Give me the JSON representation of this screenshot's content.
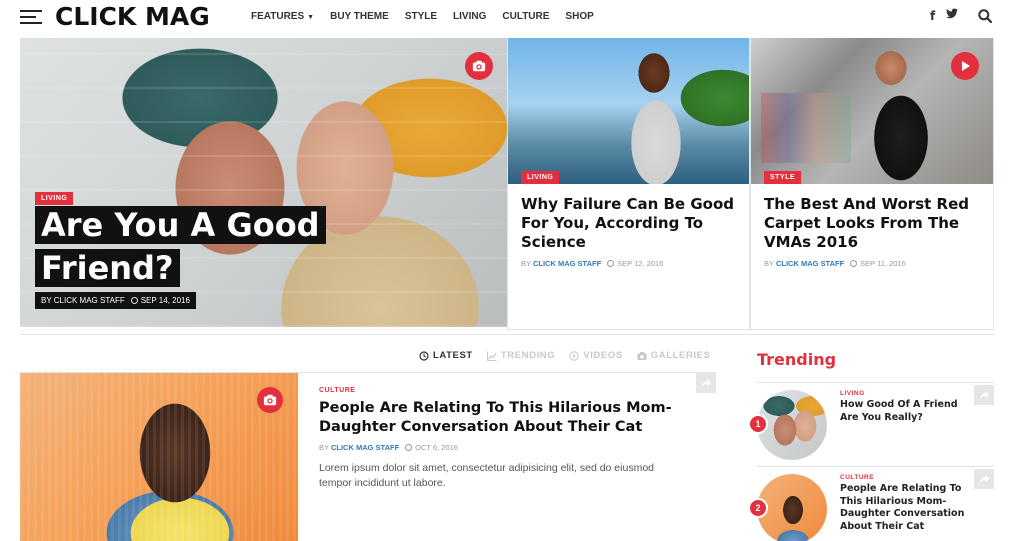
{
  "header": {
    "logo": "CLICK MAG",
    "nav": [
      {
        "label": "FEATURES",
        "has_dropdown": true
      },
      {
        "label": "BUY THEME"
      },
      {
        "label": "STYLE"
      },
      {
        "label": "LIVING"
      },
      {
        "label": "CULTURE"
      },
      {
        "label": "SHOP"
      }
    ],
    "social": {
      "facebook": "f",
      "twitter": "🐦"
    }
  },
  "hero": {
    "main": {
      "category": "LIVING",
      "title": "Are You A Good Friend?",
      "meta": "BY CLICK MAG STAFF",
      "date": "SEP 14, 2016",
      "icon": "camera-icon"
    },
    "cards": [
      {
        "category": "LIVING",
        "title": "Why Failure Can Be Good For You, According To Science",
        "by": "BY",
        "author": "CLICK MAG STAFF",
        "date": "SEP 12, 2016"
      },
      {
        "category": "STYLE",
        "title": "The Best And Worst Red Carpet Looks From The VMAs 2016",
        "by": "BY",
        "author": "CLICK MAG STAFF",
        "date": "SEP 11, 2016",
        "icon": "play-icon"
      }
    ]
  },
  "tabs": [
    {
      "label": "LATEST",
      "icon": "clock-icon",
      "active": true
    },
    {
      "label": "TRENDING",
      "icon": "chart-icon",
      "active": false
    },
    {
      "label": "VIDEOS",
      "icon": "play-circle-icon",
      "active": false
    },
    {
      "label": "GALLERIES",
      "icon": "camera-icon",
      "active": false
    }
  ],
  "article": {
    "category": "CULTURE",
    "title": "People Are Relating To This Hilarious Mom-Daughter Conversation About Their Cat",
    "by": "BY",
    "author": "CLICK MAG STAFF",
    "date": "OCT 6, 2016",
    "excerpt": "Lorem ipsum dolor sit amet, consectetur adipisicing elit, sed do eiusmod tempor incididunt ut labore."
  },
  "trending": {
    "heading": "Trending",
    "items": [
      {
        "num": "1",
        "category": "LIVING",
        "title": "How Good Of A Friend Are You Really?"
      },
      {
        "num": "2",
        "category": "CULTURE",
        "title": "People Are Relating To This Hilarious Mom-Daughter Conversation About Their Cat"
      }
    ]
  },
  "colors": {
    "accent": "#e3303e",
    "link": "#2f7bbf",
    "text": "#111111"
  }
}
